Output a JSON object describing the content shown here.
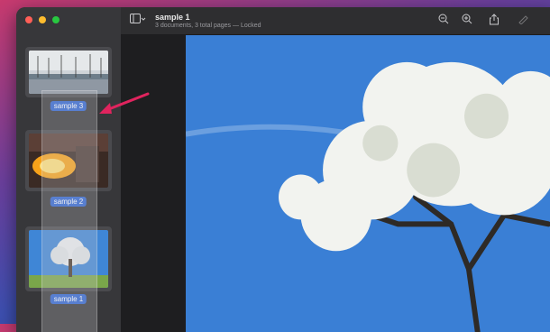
{
  "document": {
    "title": "sample 1",
    "subtitle": "3 documents, 3 total pages — Locked"
  },
  "thumbnails": [
    {
      "label": "sample 3",
      "selected": true
    },
    {
      "label": "sample 2",
      "selected": true
    },
    {
      "label": "sample 1",
      "selected": true
    }
  ],
  "toolbar": {
    "icons": [
      "sidebar-toggle-icon",
      "zoom-out-icon",
      "zoom-in-icon",
      "share-icon",
      "markup-icon"
    ]
  },
  "colors": {
    "accent": "#2d63d2",
    "arrow": "#e0245e"
  }
}
